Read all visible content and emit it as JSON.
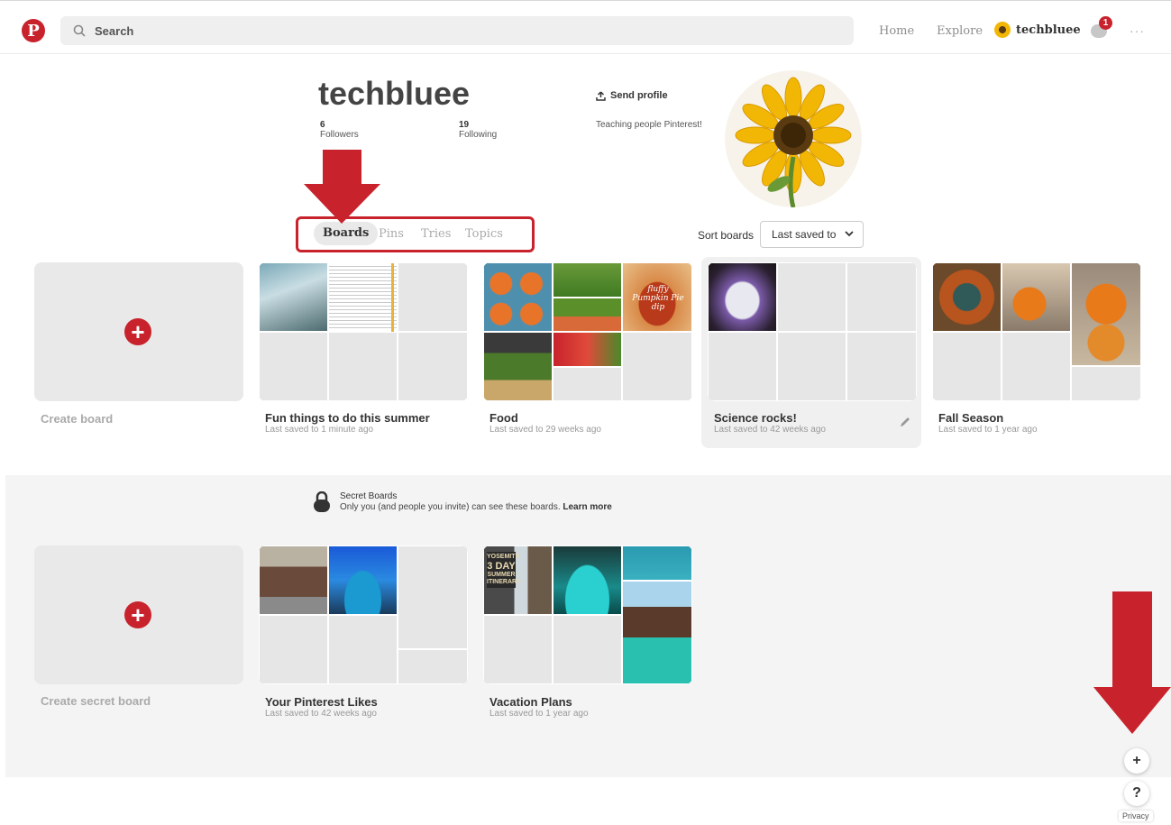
{
  "topbar": {
    "logo": "P",
    "search_placeholder": "Search",
    "nav": {
      "home": "Home",
      "explore": "Explore"
    },
    "username": "techbluee",
    "notification_count": "1",
    "more": "···"
  },
  "profile": {
    "name": "techbluee",
    "followers_count": "6",
    "followers_label": "Followers",
    "following_count": "19",
    "following_label": "Following",
    "send_profile": "Send profile",
    "bio": "Teaching people Pinterest!"
  },
  "tabs": [
    "Boards",
    "Pins",
    "Tries",
    "Topics"
  ],
  "sort": {
    "label": "Sort boards",
    "selected": "Last saved to"
  },
  "boards": [
    {
      "title": "Create board"
    },
    {
      "title": "Fun things to do this summer",
      "sub": "Last saved to 1 minute ago"
    },
    {
      "title": "Food",
      "sub": "Last saved to 29 weeks ago"
    },
    {
      "title": "Science rocks!",
      "sub": "Last saved to 42 weeks ago"
    },
    {
      "title": "Fall Season",
      "sub": "Last saved to 1 year ago"
    }
  ],
  "secret": {
    "title": "Secret Boards",
    "desc": "Only you (and people you invite) can see these boards.",
    "learn_more": "Learn more",
    "boards": [
      {
        "title": "Create secret board"
      },
      {
        "title": "Your Pinterest Likes",
        "sub": "Last saved to 42 weeks ago"
      },
      {
        "title": "Vacation Plans",
        "sub": "Last saved to 1 year ago"
      }
    ]
  },
  "image_text": {
    "pumpkin_pie": "fluffy Pumpkin Pie dip",
    "yosemite": "YOSEMITE",
    "three_day": "3 DAY",
    "summer": "SUMMER",
    "itinerary": "ITINERARY"
  },
  "floating": {
    "plus": "+",
    "help": "?",
    "privacy": "Privacy"
  },
  "colors": {
    "brand_red": "#c8232c",
    "annotation_red": "#c8232c"
  }
}
